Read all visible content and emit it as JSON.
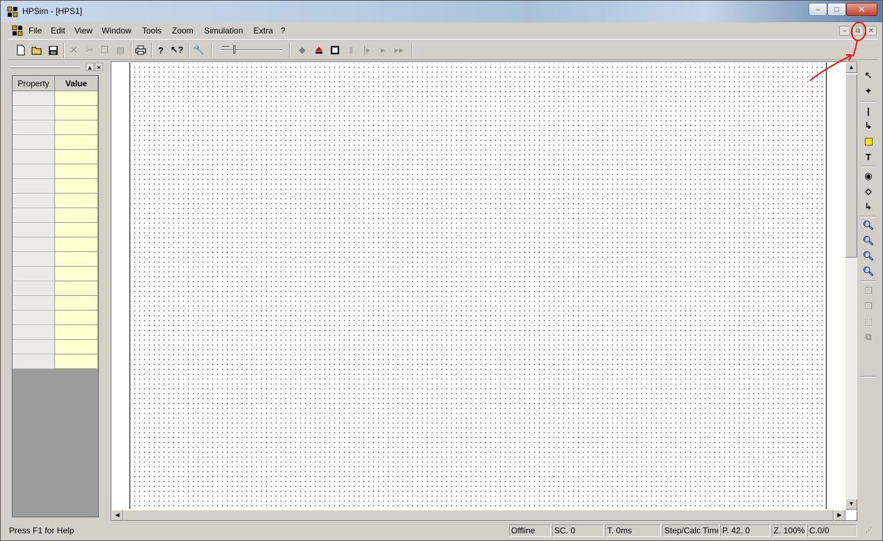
{
  "window": {
    "title": "HPSim - [HPS1]"
  },
  "menu": {
    "items": [
      "File",
      "Edit",
      "View",
      "Window",
      "Tools",
      "Zoom",
      "Simulation",
      "Extra",
      "?"
    ]
  },
  "property_panel": {
    "col_property": "Property",
    "col_value": "Value",
    "row_count": 19
  },
  "status": {
    "help": "Press F1 for Help",
    "mode": "Offline",
    "sc": "SC. 0",
    "time": "T. 0ms",
    "step": "Step/Calc Time",
    "position": "P. 42, 0",
    "zoom": "Z. 100%",
    "count": "C.0/0"
  },
  "colors": {
    "chrome": "#d4d0c8",
    "value_cell": "#ffffd0",
    "annotation": "#e8120c"
  },
  "toolbar_icons": [
    "new-icon",
    "open-icon",
    "save-icon",
    "cut-icon",
    "delete-icon",
    "copy-icon",
    "paste-icon",
    "print-icon",
    "help-icon",
    "context-help-icon",
    "settings-icon",
    "speed-slider",
    "reset-icon",
    "eject-icon",
    "stop-icon",
    "pause-icon",
    "step-icon",
    "play-icon",
    "fast-forward-icon"
  ],
  "palette_icons": [
    "select-arrow-icon",
    "move-icon",
    "line-icon",
    "connector-icon",
    "rectangle-icon",
    "text-icon",
    "place-icon",
    "transition-icon",
    "arc-icon",
    "zoom-in-icon",
    "zoom-icon",
    "zoom-out-icon",
    "zoom-fit-icon",
    "bring-front-icon",
    "send-back-icon",
    "group-icon",
    "ungroup-icon"
  ]
}
